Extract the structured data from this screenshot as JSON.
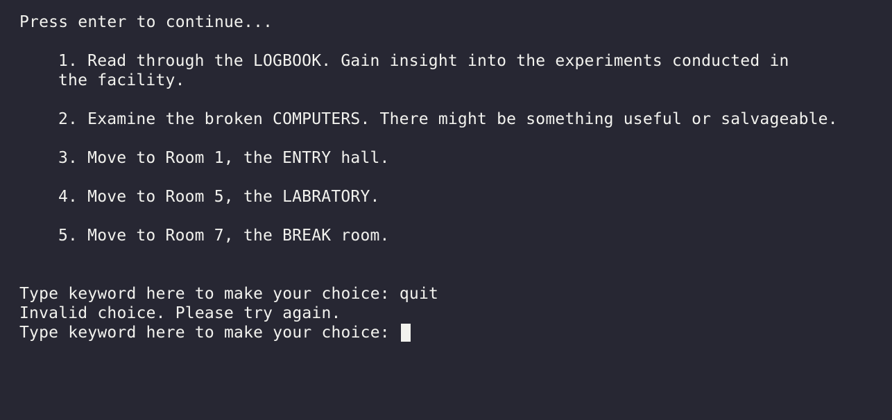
{
  "terminal": {
    "continue_prompt": "Press enter to continue...",
    "options": [
      {
        "line1": "1. Read through the LOGBOOK. Gain insight into the experiments conducted in",
        "line2": "the facility."
      },
      {
        "line1": "2. Examine the broken COMPUTERS. There might be something useful or salvageable."
      },
      {
        "line1": "3. Move to Room 1, the ENTRY hall."
      },
      {
        "line1": "4. Move to Room 5, the LABRATORY."
      },
      {
        "line1": "5. Move to Room 7, the BREAK room."
      }
    ],
    "prompt_label": "Type keyword here to make your choice: ",
    "previous_input": "quit",
    "error_message": "Invalid choice. Please try again.",
    "current_input": ""
  },
  "colors": {
    "background": "#272733",
    "foreground": "#f2f2ee"
  }
}
